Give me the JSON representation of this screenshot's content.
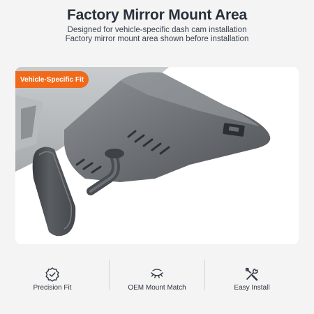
{
  "header": {
    "title": "Factory Mirror Mount Area",
    "subtitle_line1": "Designed for vehicle-specific dash cam installation",
    "subtitle_line2": "Factory mirror mount area shown before installation"
  },
  "badge": {
    "label": "Vehicle-Specific Fit",
    "color": "#f06a1c"
  },
  "features": [
    {
      "label": "Precision Fit",
      "icon": "badge-check-icon"
    },
    {
      "label": "OEM Mount Match",
      "icon": "eye-icon"
    },
    {
      "label": "Easy Install",
      "icon": "tools-icon"
    }
  ]
}
